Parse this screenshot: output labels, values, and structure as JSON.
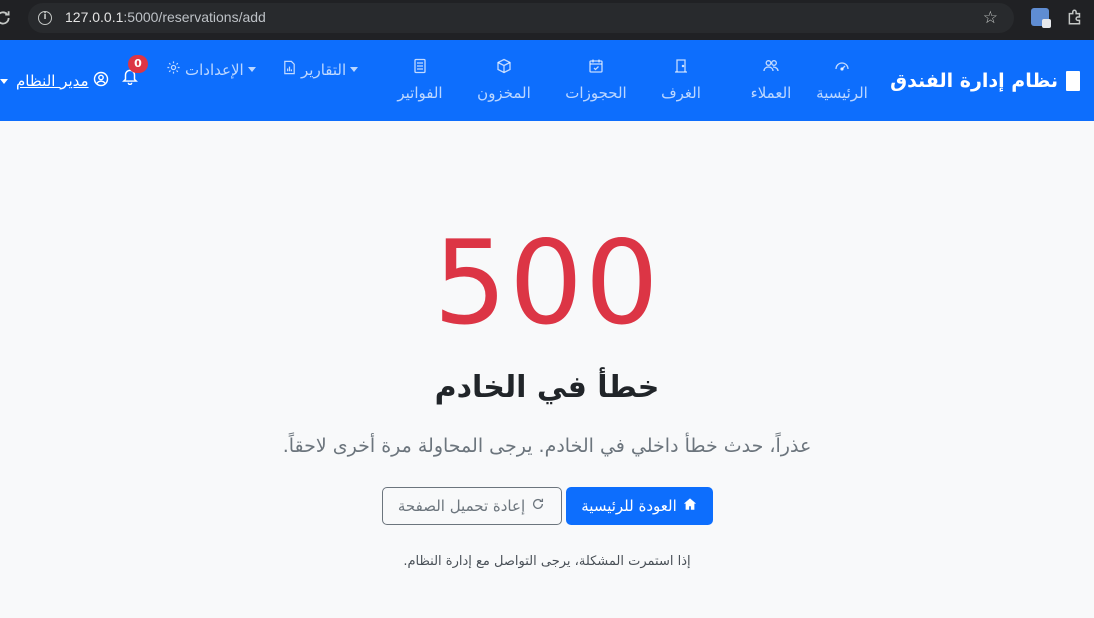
{
  "browser": {
    "url_host": "127.0.0.1",
    "url_path": ":5000/reservations/add"
  },
  "navbar": {
    "brand": "نظام إدارة الفندق",
    "items": [
      {
        "label": "الرئيسية",
        "icon": "speedometer-icon"
      },
      {
        "label": "العملاء",
        "icon": "people-icon"
      },
      {
        "label": "الغرف",
        "icon": "door-icon"
      },
      {
        "label": "الحجوزات",
        "icon": "calendar-check-icon"
      },
      {
        "label": "المخزون",
        "icon": "box-icon"
      },
      {
        "label": "الفواتير",
        "icon": "receipt-icon"
      }
    ],
    "reports_label": "التقارير",
    "settings_label": "الإعدادات",
    "notification_count": "0",
    "user_label": "مدير النظام"
  },
  "error": {
    "code": "500",
    "title": "خطأ في الخادم",
    "message": "عذراً، حدث خطأ داخلي في الخادم. يرجى المحاولة مرة أخرى لاحقاً.",
    "home_button": "العودة للرئيسية",
    "reload_button": "إعادة تحميل الصفحة",
    "note": "إذا استمرت المشكلة، يرجى التواصل مع إدارة النظام."
  },
  "colors": {
    "primary": "#0d6efd",
    "danger": "#dc3545",
    "background": "#f8f9fa"
  }
}
